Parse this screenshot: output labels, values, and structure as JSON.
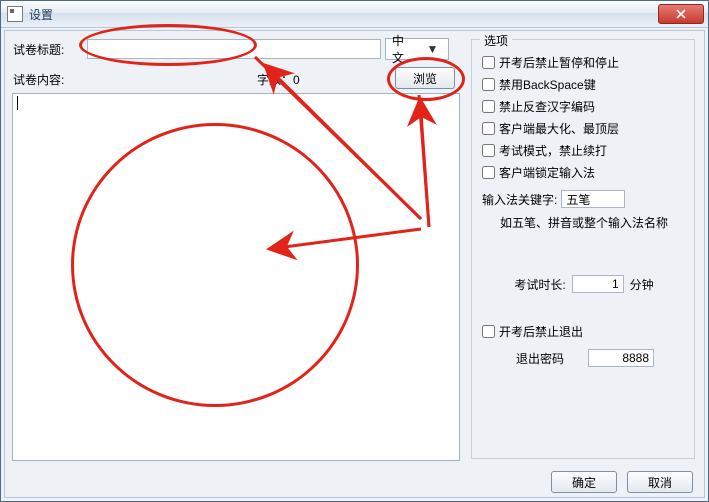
{
  "window": {
    "title": "设置"
  },
  "left": {
    "title_label": "试卷标题:",
    "title_value": "",
    "language_value": "中文",
    "content_label": "试卷内容:",
    "charcount_label": "字数：",
    "charcount_value": "0",
    "browse_button": "浏览",
    "textarea_value": ""
  },
  "options": {
    "legend": "选项",
    "cb_pause": "开考后禁止暂停和停止",
    "cb_backspace": "禁用BackSpace键",
    "cb_fancha": "禁止反查汉字编码",
    "cb_maximize": "客户端最大化、最顶层",
    "cb_exam_mode": "考试模式，禁止续打",
    "cb_lock_ime": "客户端锁定输入法",
    "ime_label": "输入法关键字:",
    "ime_value": "五笔",
    "ime_hint": "如五笔、拼音或整个输入法名称",
    "duration_label": "考试时长:",
    "duration_value": "1",
    "duration_unit": "分钟",
    "cb_exit": "开考后禁止退出",
    "exit_pwd_label": "退出密码",
    "exit_pwd_value": "8888"
  },
  "footer": {
    "ok": "确定",
    "cancel": "取消"
  }
}
